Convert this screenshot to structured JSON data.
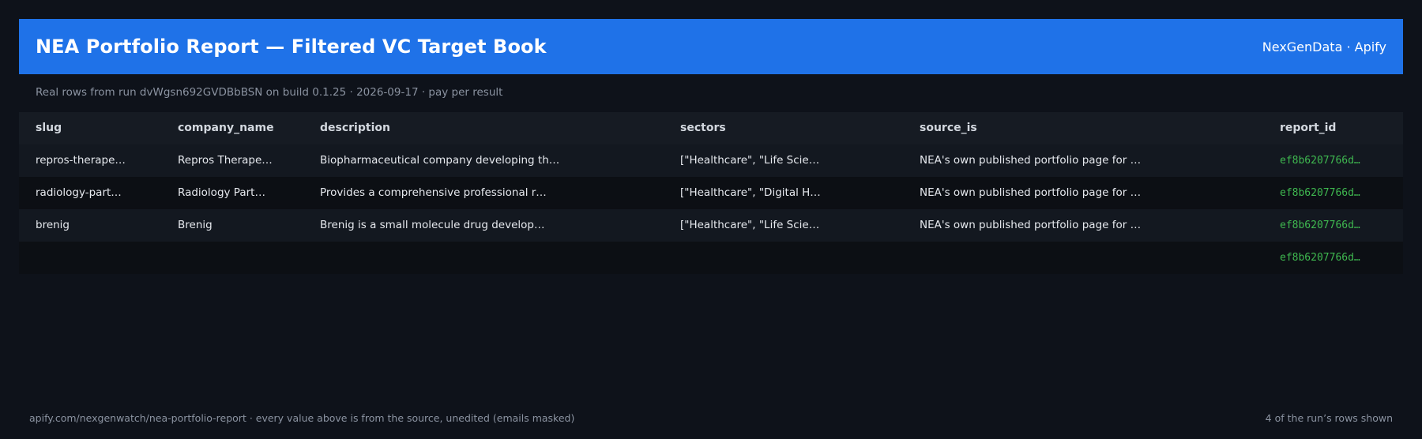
{
  "header": {
    "title": "NEA Portfolio Report — Filtered VC Target Book",
    "brand": "NexGenData · Apify"
  },
  "subtitle": "Real rows from run dvWgsn692GVDBbBSN on build 0.1.25 · 2026-09-17 · pay per result",
  "table": {
    "columns": [
      "slug",
      "company_name",
      "description",
      "sectors",
      "source_is",
      "report_id"
    ],
    "rows": [
      [
        "repros-therape…",
        "Repros Therape…",
        "Biopharmaceutical company developing th…",
        "[\"Healthcare\", \"Life Scie…",
        "NEA's own published portfolio page for …",
        "ef8b6207766d…"
      ],
      [
        "radiology-part…",
        "Radiology Part…",
        "Provides a comprehensive professional r…",
        "[\"Healthcare\", \"Digital H…",
        "NEA's own published portfolio page for …",
        "ef8b6207766d…"
      ],
      [
        "brenig",
        "Brenig",
        "Brenig is a small molecule drug develop…",
        "[\"Healthcare\", \"Life Scie…",
        "NEA's own published portfolio page for …",
        "ef8b6207766d…"
      ],
      [
        "",
        "",
        "",
        "",
        "",
        "ef8b6207766d…"
      ]
    ]
  },
  "footer": {
    "left": "apify.com/nexgenwatch/nea-portfolio-report  ·  every value above is from the source, unedited (emails masked)",
    "right": "4 of the run’s rows shown"
  },
  "colors": {
    "background": "#0e121a",
    "header": "#1f72e8",
    "report_id": "#3fb950"
  }
}
